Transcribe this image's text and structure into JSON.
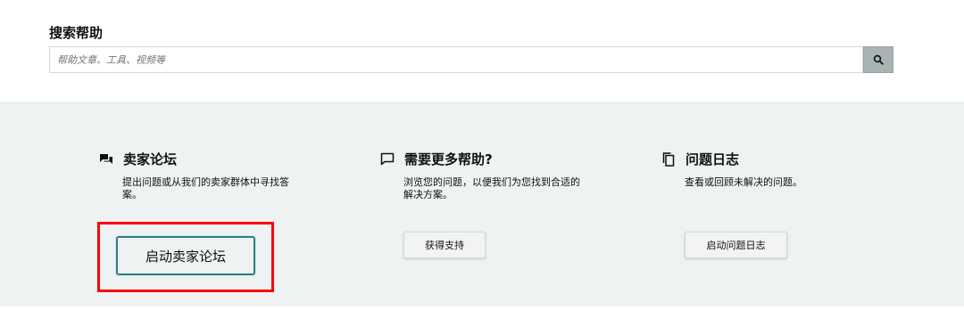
{
  "search": {
    "title": "搜索帮助",
    "placeholder": "帮助文章、工具、视频等",
    "button_icon": "search-icon"
  },
  "cards": [
    {
      "icon": "chat-bubbles-icon",
      "title": "卖家论坛",
      "description": "提出问题或从我们的卖家群体中寻找答案。",
      "button_label": "启动卖家论坛"
    },
    {
      "icon": "speech-bubble-icon",
      "title": "需要更多帮助?",
      "description": "浏览您的问题，以便我们为您找到合适的解决方案。",
      "button_label": "获得支持"
    },
    {
      "icon": "copy-pages-icon",
      "title": "问题日志",
      "description": "查看或回顾未解决的问题。",
      "button_label": "启动问题日志"
    }
  ],
  "colors": {
    "cards_background": "#eef2f2",
    "highlight": "#ff0000",
    "focus_border": "#2f7f8a"
  }
}
